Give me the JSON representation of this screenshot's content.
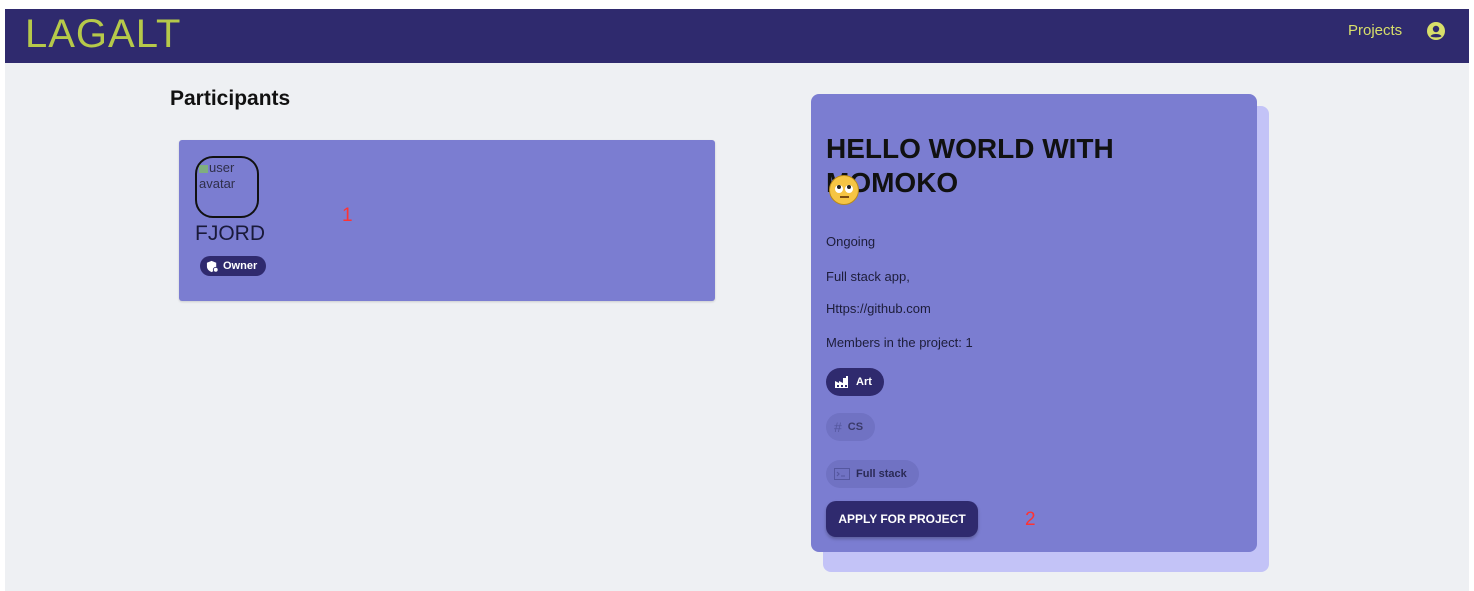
{
  "app": {
    "logo": "LAGALT"
  },
  "nav": {
    "projects_label": "Projects",
    "account_icon": "account-circle-icon"
  },
  "participants": {
    "title": "Participants",
    "items": [
      {
        "avatar_alt": "user avatar",
        "name": "FJORD",
        "role": "Owner",
        "role_icon": "shield-icon"
      }
    ]
  },
  "project": {
    "title": "HELLO WORLD WITH MOMOKO",
    "emoji_icon": "eye-roll-emoji-icon",
    "status": "Ongoing",
    "type": "Full stack app,",
    "link": "Https://github.com",
    "members": "Members in the project: 1",
    "tags": [
      {
        "label": "Art",
        "icon": "factory-icon",
        "active": true
      },
      {
        "label": "CS",
        "icon": "hashtag-icon",
        "active": false
      },
      {
        "label": "Full stack",
        "icon": "terminal-icon",
        "active": false
      }
    ],
    "apply_label": "APPLY FOR PROJECT"
  },
  "markers": {
    "one": "1",
    "two": "2"
  },
  "colors": {
    "navbar": "#2f2a6e",
    "logo": "#b6c94a",
    "card": "#7b7dd1",
    "card_shadow": "#c3c3f7",
    "marker": "#ff3333"
  }
}
